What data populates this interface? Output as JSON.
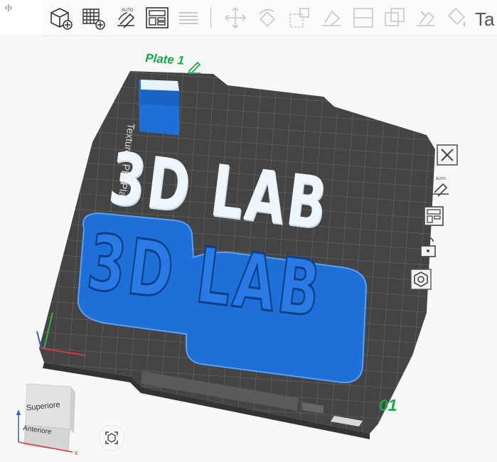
{
  "toolbar": {
    "buttons": [
      {
        "name": "add-object-button",
        "icon": "add-cube-icon"
      },
      {
        "name": "add-plate-button",
        "icon": "add-plate-grid-icon"
      },
      {
        "name": "auto-orient-button",
        "icon": "auto-orient-icon",
        "label": "AUTO"
      },
      {
        "name": "arrange-button",
        "icon": "arrange-layout-icon"
      },
      {
        "name": "split-button",
        "icon": "layers-icon"
      },
      {
        "name": "move-button",
        "icon": "move-arrows-icon"
      },
      {
        "name": "rotate-button",
        "icon": "rotate-icon"
      },
      {
        "name": "scale-button",
        "icon": "scale-icon"
      },
      {
        "name": "lay-on-face-button",
        "icon": "lay-on-face-icon"
      },
      {
        "name": "cut-button",
        "icon": "cut-icon"
      },
      {
        "name": "boolean-button",
        "icon": "boolean-icon"
      },
      {
        "name": "support-paint-button",
        "icon": "support-paint-icon"
      },
      {
        "name": "color-paint-button",
        "icon": "color-paint-icon"
      },
      {
        "name": "text-button",
        "icon": "text-icon",
        "label": "Ta"
      }
    ]
  },
  "viewport": {
    "plate_label": "Plate 1",
    "plate_number": "01",
    "plate_type_text": "Textured PEI Plate",
    "model_text_white": "3D LAB",
    "model_text_blue": "3D LAB",
    "accent_color": "#18a84a",
    "model_blue": "#1f6fd8",
    "model_white": "#eef6fb",
    "plate_color": "#4a4a4a"
  },
  "side_toolbar": [
    {
      "name": "close-plate-button",
      "icon": "close-x-icon"
    },
    {
      "name": "auto-orient-plate-button",
      "icon": "auto-orient-icon",
      "label": "AUTO"
    },
    {
      "name": "arrange-plate-button",
      "icon": "arrange-layout-icon"
    },
    {
      "name": "lock-plate-button",
      "icon": "unlock-icon"
    },
    {
      "name": "plate-settings-button",
      "icon": "hex-nut-icon"
    }
  ],
  "nav_cube": {
    "top_label": "Superiore",
    "front_label": "Anteriore",
    "x_axis_label": "x"
  }
}
